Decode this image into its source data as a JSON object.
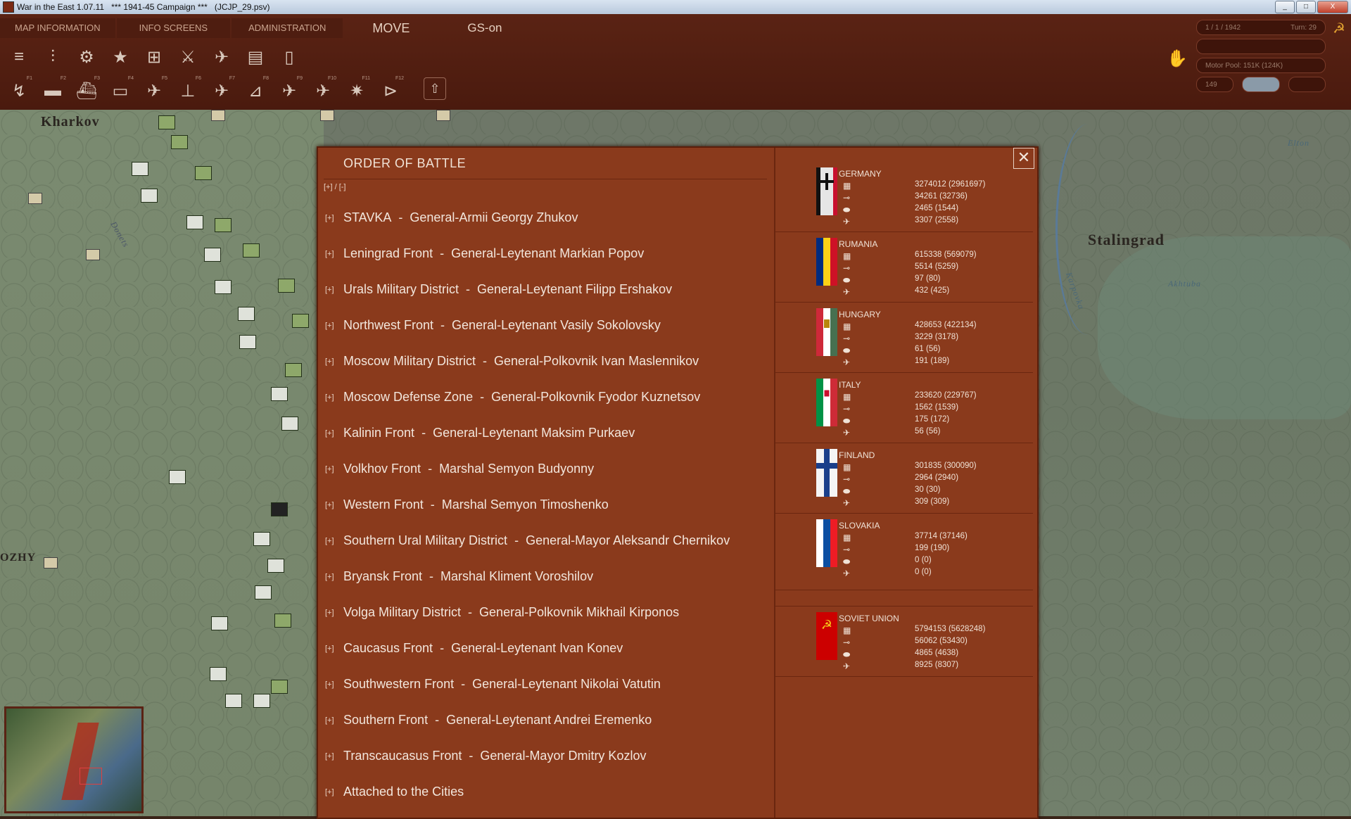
{
  "window": {
    "app_title": "War in the East 1.07.11",
    "campaign": "***   1941-45 Campaign   ***",
    "save_file": "(JCJP_29.psv)",
    "buttons": [
      "_",
      "□",
      "X"
    ]
  },
  "menu": {
    "map_information": "MAP INFORMATION",
    "info_screens": "INFO SCREENS",
    "administration": "ADMINISTRATION",
    "move": "MOVE",
    "gs": "GS-on"
  },
  "toolbar_row1_icons": [
    "stack-icon",
    "sliders-icon",
    "gear-icon",
    "star-icon",
    "target-icon",
    "crossed-swords-icon",
    "artillery-icon",
    "rail-icon",
    "supply-icon"
  ],
  "toolbar_row2_keys": [
    "F1",
    "F2",
    "F3",
    "F4",
    "F5",
    "F6",
    "F7",
    "F8",
    "F9",
    "F10",
    "F11",
    "F12"
  ],
  "status": {
    "date": "1 / 1 / 1942",
    "turn": "Turn: 29",
    "motor_pool": "Motor Pool:  151K (124K)",
    "count": "149"
  },
  "map": {
    "cities": [
      "Kharkov",
      "Stalingrad",
      "OZHY"
    ],
    "rivers": [
      "Donets",
      "Akhtuba",
      "Karpovka",
      "Elton"
    ]
  },
  "oob": {
    "title": "ORDER OF BATTLE",
    "expand_all": "[+] / [-]",
    "expand_marker": "[+]",
    "commands": [
      {
        "unit": "STAVKA",
        "commander": "General-Armii Georgy Zhukov"
      },
      {
        "unit": "Leningrad Front",
        "commander": "General-Leytenant Markian Popov"
      },
      {
        "unit": "Urals Military District",
        "commander": "General-Leytenant Filipp Ershakov"
      },
      {
        "unit": "Northwest Front",
        "commander": "General-Leytenant Vasily Sokolovsky"
      },
      {
        "unit": "Moscow Military District",
        "commander": "General-Polkovnik Ivan Maslennikov"
      },
      {
        "unit": "Moscow Defense Zone",
        "commander": "General-Polkovnik Fyodor Kuznetsov"
      },
      {
        "unit": "Kalinin Front",
        "commander": "General-Leytenant Maksim Purkaev"
      },
      {
        "unit": "Volkhov Front",
        "commander": "Marshal Semyon Budyonny"
      },
      {
        "unit": "Western Front",
        "commander": "Marshal Semyon Timoshenko"
      },
      {
        "unit": "Southern Ural Military District",
        "commander": "General-Mayor Aleksandr Chernikov"
      },
      {
        "unit": "Bryansk Front",
        "commander": "Marshal Kliment Voroshilov"
      },
      {
        "unit": "Volga Military District",
        "commander": "General-Polkovnik Mikhail Kirponos"
      },
      {
        "unit": "Caucasus Front",
        "commander": "General-Leytenant Ivan Konev"
      },
      {
        "unit": "Southwestern Front",
        "commander": "General-Leytenant Nikolai Vatutin"
      },
      {
        "unit": "Southern Front",
        "commander": "General-Leytenant Andrei Eremenko"
      },
      {
        "unit": "Transcaucasus Front",
        "commander": "General-Mayor Dmitry Kozlov"
      },
      {
        "unit": "Attached to the Cities",
        "commander": ""
      }
    ],
    "close": "✕",
    "nations": [
      {
        "name": "GERMANY",
        "flag": "germany",
        "men": "3274012 (2961697)",
        "guns": "34261 (32736)",
        "afv": "2465 (1544)",
        "aircraft": "3307 (2558)"
      },
      {
        "name": "RUMANIA",
        "flag": "rumania",
        "men": "615338 (569079)",
        "guns": "5514 (5259)",
        "afv": "97 (80)",
        "aircraft": "432 (425)"
      },
      {
        "name": "HUNGARY",
        "flag": "hungary",
        "men": "428653 (422134)",
        "guns": "3229 (3178)",
        "afv": "61 (56)",
        "aircraft": "191 (189)"
      },
      {
        "name": "ITALY",
        "flag": "italy",
        "men": "233620 (229767)",
        "guns": "1562 (1539)",
        "afv": "175 (172)",
        "aircraft": "56 (56)"
      },
      {
        "name": "FINLAND",
        "flag": "finland",
        "men": "301835 (300090)",
        "guns": "2964 (2940)",
        "afv": "30 (30)",
        "aircraft": "309 (309)"
      },
      {
        "name": "SLOVAKIA",
        "flag": "slovakia",
        "men": "37714 (37146)",
        "guns": "199 (190)",
        "afv": "0 (0)",
        "aircraft": "0 (0)"
      },
      {
        "name": "SOVIET UNION",
        "flag": "soviet",
        "men": "5794153 (5628248)",
        "guns": "56062 (53430)",
        "afv": "4865 (4638)",
        "aircraft": "8925 (8307)"
      }
    ]
  }
}
